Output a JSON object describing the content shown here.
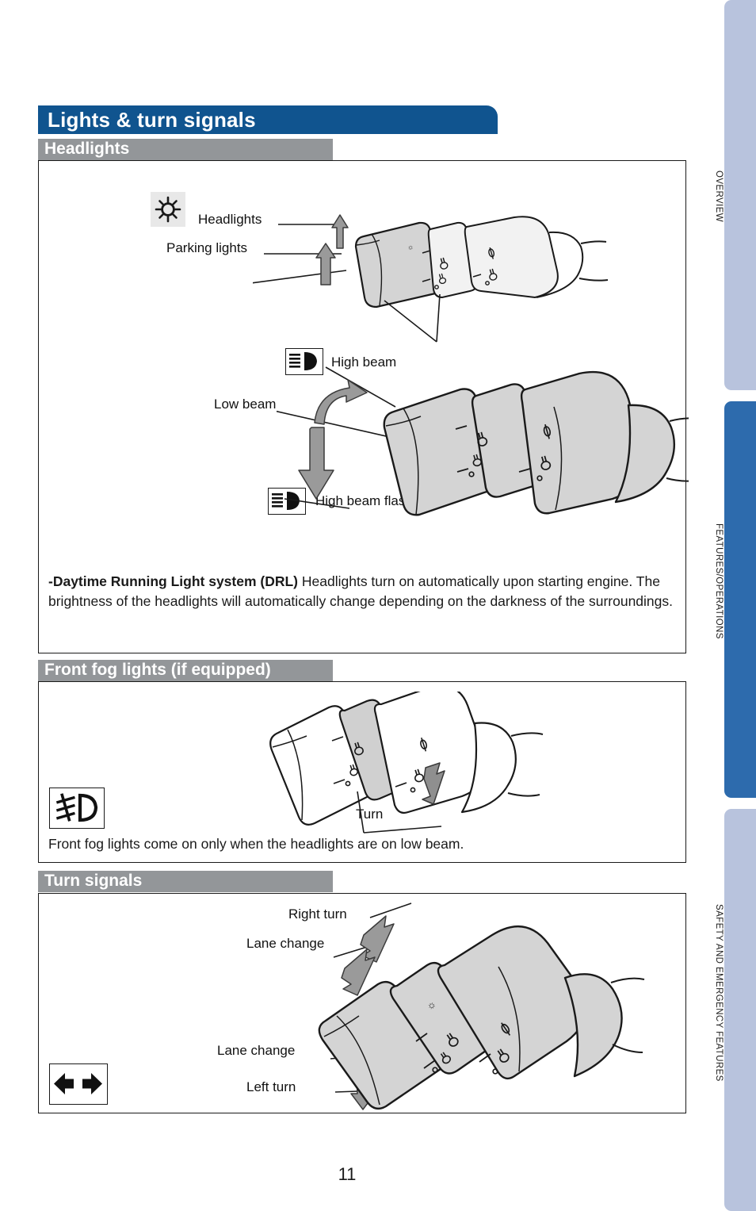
{
  "page": {
    "number": "11",
    "title": "Lights & turn signals",
    "colors": {
      "title_blue": "#10548f",
      "section_gray": "#939699",
      "tab_light_blue": "#b8c3dd",
      "tab_active_blue": "#2d6bad",
      "ink": "#1a1a1a"
    }
  },
  "side_tabs": [
    {
      "label": "OVERVIEW",
      "state": "inactive"
    },
    {
      "label": "FEATURES/OPERATIONS",
      "state": "active"
    },
    {
      "label": "SAFETY AND EMERGENCY FEATURES",
      "state": "inactive"
    }
  ],
  "sections": [
    {
      "id": "headlights",
      "header": "Headlights",
      "diagram_top": {
        "icon_name": "headlight-sun-icon",
        "callouts": [
          "Headlights",
          "Parking lights"
        ]
      },
      "diagram_bottom": {
        "callouts": [
          "High beam",
          "Low beam",
          "High beam flasher"
        ],
        "icons": [
          "high-beam-icon",
          "high-beam-flasher-icon"
        ]
      },
      "note": {
        "lead": "-Daytime Running Light system (DRL)",
        "body": " Headlights turn on automatically upon starting engine. The brightness of the headlights will automatically change depending on the darkness of the surroundings."
      }
    },
    {
      "id": "front-fog-lights",
      "header": "Front fog lights (if equipped)",
      "diagram": {
        "icon_name": "fog-light-icon",
        "callouts": [
          "Turn"
        ]
      },
      "note": "Front fog lights come on only when the headlights are on low beam."
    },
    {
      "id": "turn-signals",
      "header": "Turn signals",
      "diagram": {
        "icon_name": "turn-signal-arrows-icon",
        "callouts": [
          "Right turn",
          "Lane change",
          "Lane change",
          "Left turn"
        ]
      }
    }
  ]
}
